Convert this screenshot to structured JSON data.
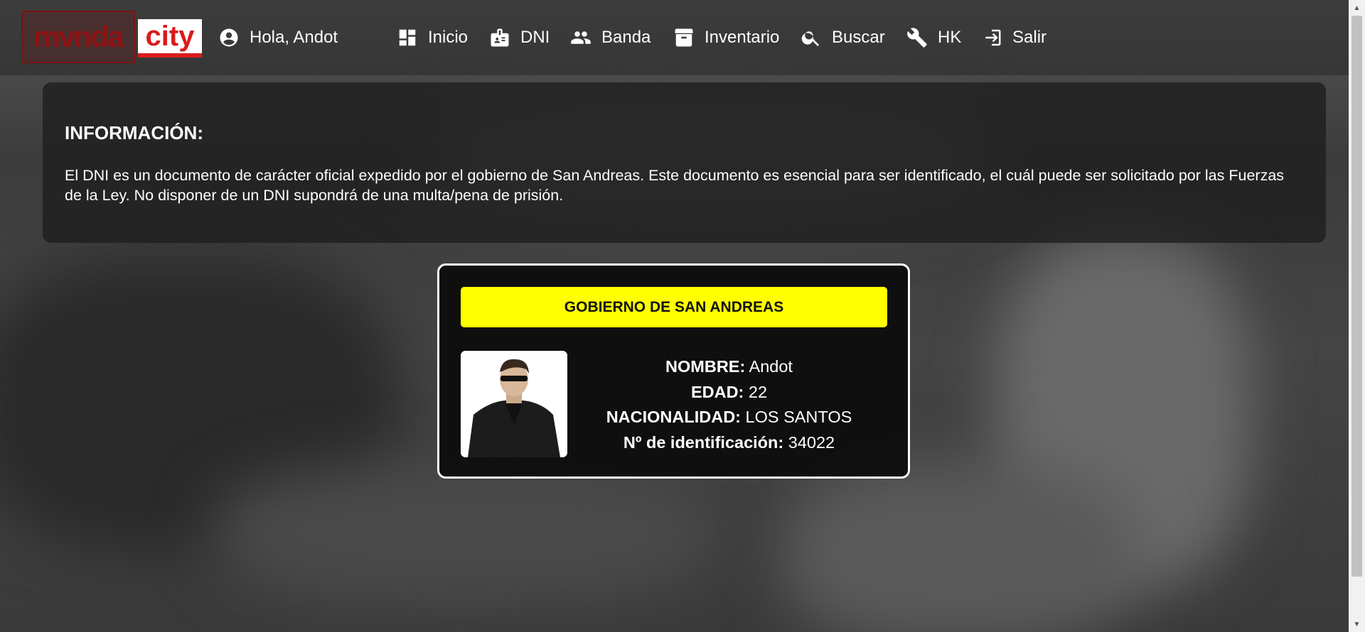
{
  "header": {
    "logo": {
      "part1": "mvnda",
      "part2": "city"
    },
    "greeting": "Hola, Andot",
    "nav": [
      {
        "label": "Inicio",
        "icon": "dashboard-icon"
      },
      {
        "label": "DNI",
        "icon": "id-badge-icon"
      },
      {
        "label": "Banda",
        "icon": "group-icon"
      },
      {
        "label": "Inventario",
        "icon": "archive-box-icon"
      },
      {
        "label": "Buscar",
        "icon": "search-icon"
      },
      {
        "label": "HK",
        "icon": "tools-icon"
      },
      {
        "label": "Salir",
        "icon": "logout-icon"
      }
    ]
  },
  "info": {
    "title": "INFORMACIÓN:",
    "text": "El DNI es un documento de carácter oficial expedido por el gobierno de San Andreas. Este documento es esencial para ser identificado, el cuál puede ser solicitado por las Fuerzas de la Ley. No disponer de un DNI supondrá de una multa/pena de prisión."
  },
  "card": {
    "header": "GOBIERNO DE SAN ANDREAS",
    "fields": [
      {
        "label": "NOMBRE:",
        "value": "Andot"
      },
      {
        "label": "EDAD:",
        "value": "22"
      },
      {
        "label": "NACIONALIDAD:",
        "value": "LOS SANTOS"
      },
      {
        "label": "Nº de identificación:",
        "value": "34022"
      }
    ]
  },
  "colors": {
    "accent_yellow": "#ffff00",
    "logo_red": "#d91c1c"
  }
}
